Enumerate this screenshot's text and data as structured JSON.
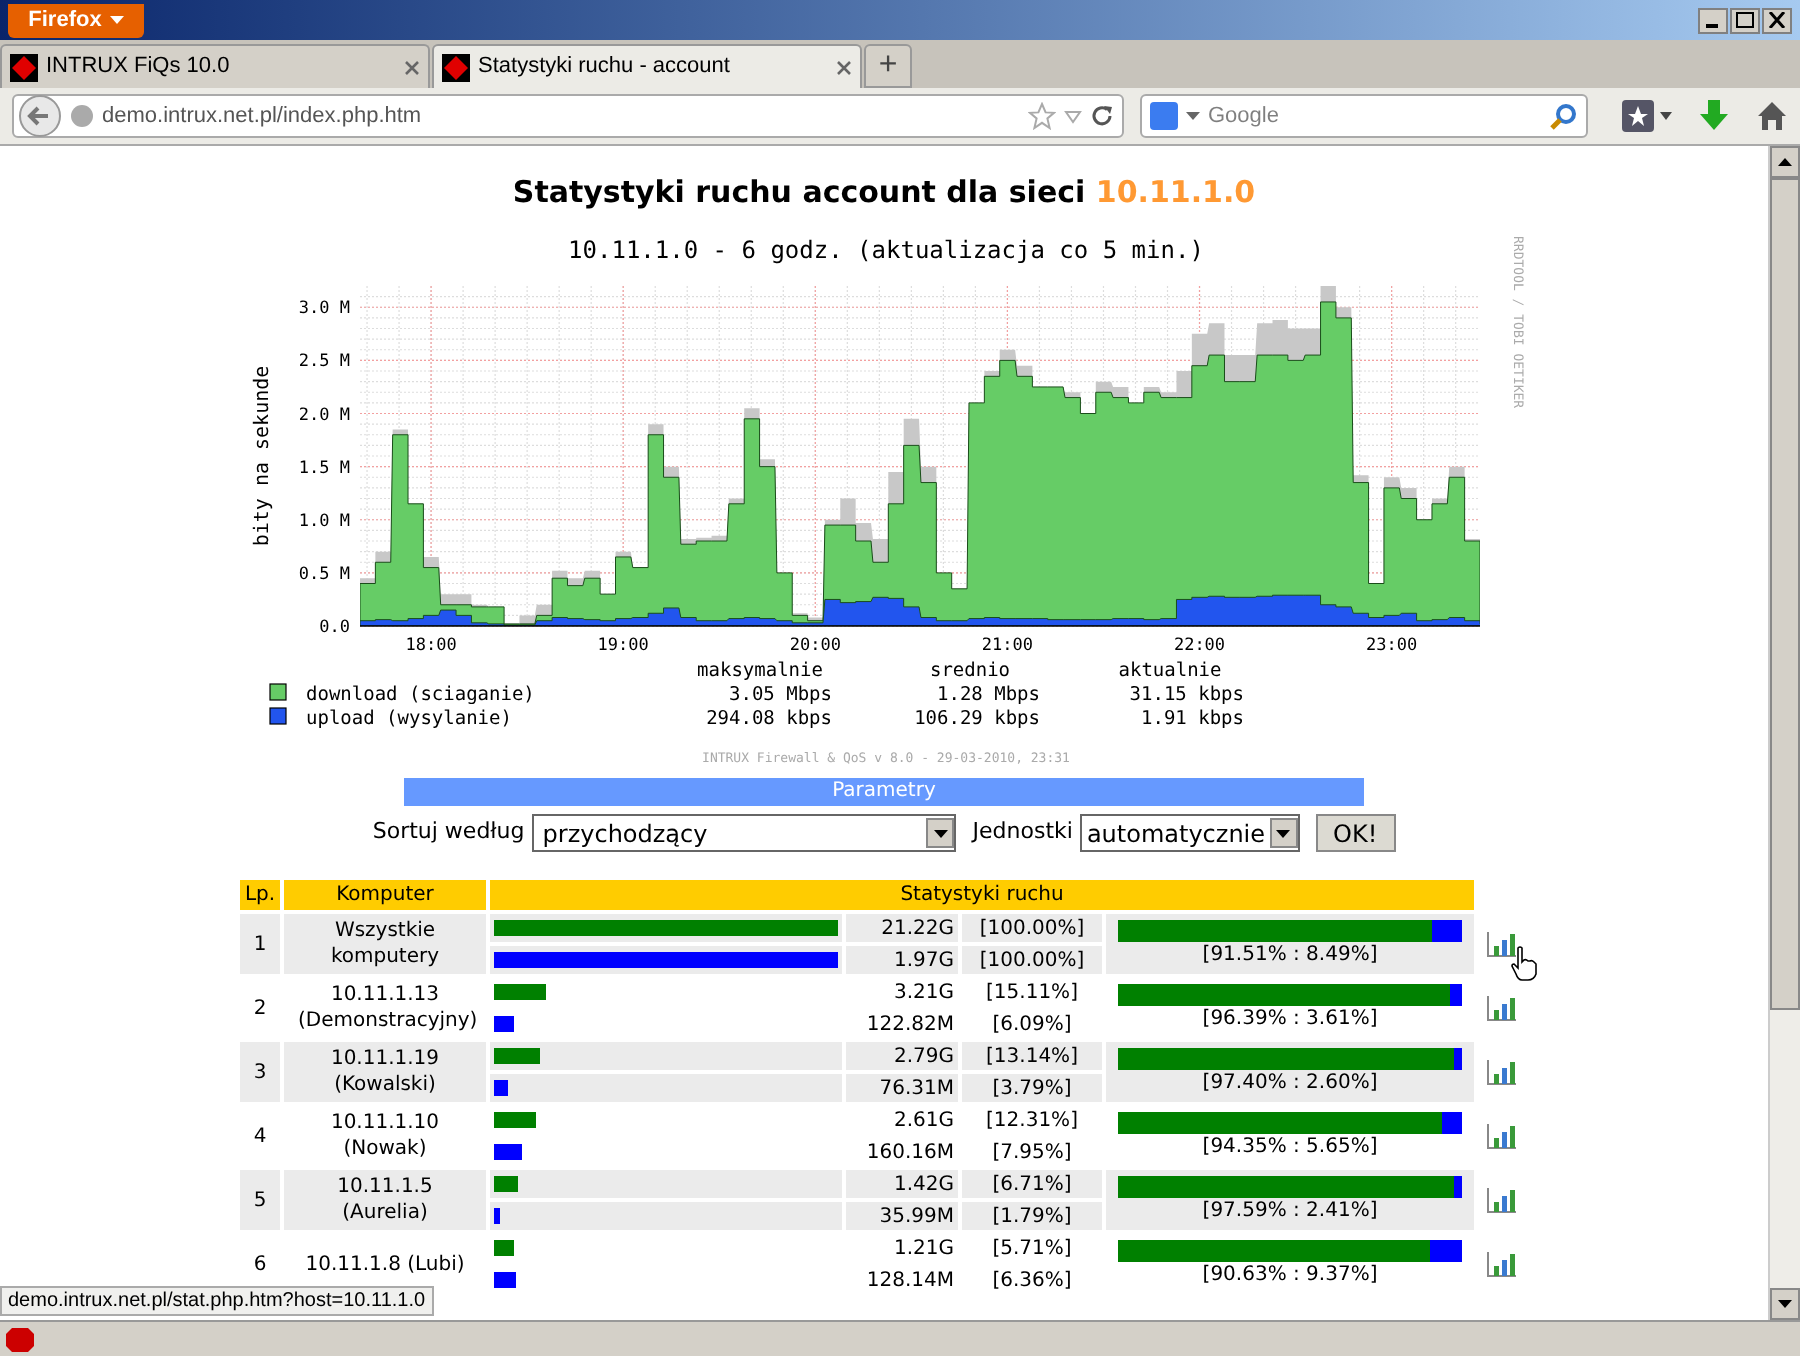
{
  "browser": {
    "menu_button": "Firefox",
    "tabs": [
      {
        "title": "INTRUX FiQs 10.0",
        "selected": false
      },
      {
        "title": "Statystyki ruchu - account",
        "selected": true
      }
    ],
    "new_tab": "+",
    "url": "demo.intrux.net.pl/index.php.htm",
    "search_placeholder": "Google"
  },
  "page": {
    "title": "Statystyki ruchu account dla sieci ",
    "network": "10.11.1.0",
    "graph": {
      "subtitle": "10.11.1.0 - 6 godz. (aktualizacja co 5 min.)",
      "credit": "RRDTOOL / TOBI OETIKER",
      "footer": "INTRUX Firewall & QoS v 8.0 - 29-03-2010, 23:31",
      "chart_data": {
        "type": "area",
        "ylabel": "bity na sekunde",
        "xlim": [
          17.63,
          23.46
        ],
        "ylim": [
          0,
          3.2
        ],
        "grid": true,
        "legend": "bottom",
        "xticks": [
          {
            "value": 18,
            "label": "18:00"
          },
          {
            "value": 19,
            "label": "19:00"
          },
          {
            "value": 20,
            "label": "20:00"
          },
          {
            "value": 21,
            "label": "21:00"
          },
          {
            "value": 22,
            "label": "22:00"
          },
          {
            "value": 23,
            "label": "23:00"
          }
        ],
        "yticks": [
          {
            "value": 0,
            "label": "0.0"
          },
          {
            "value": 0.5,
            "label": "0.5 M"
          },
          {
            "value": 1,
            "label": "1.0 M"
          },
          {
            "value": 1.5,
            "label": "1.5 M"
          },
          {
            "value": 2,
            "label": "2.0 M"
          },
          {
            "value": 2.5,
            "label": "2.5 M"
          },
          {
            "value": 3,
            "label": "3.0 M"
          }
        ],
        "x": [
          17.63,
          17.71,
          17.8,
          17.88,
          17.96,
          18.05,
          18.13,
          18.21,
          18.3,
          18.38,
          18.46,
          18.55,
          18.63,
          18.71,
          18.8,
          18.88,
          18.96,
          19.05,
          19.13,
          19.21,
          19.3,
          19.38,
          19.46,
          19.55,
          19.63,
          19.71,
          19.8,
          19.88,
          19.96,
          20.05,
          20.13,
          20.21,
          20.3,
          20.38,
          20.46,
          20.55,
          20.63,
          20.71,
          20.8,
          20.88,
          20.96,
          21.05,
          21.13,
          21.21,
          21.3,
          21.38,
          21.46,
          21.55,
          21.63,
          21.71,
          21.8,
          21.88,
          21.96,
          22.05,
          22.13,
          22.21,
          22.3,
          22.38,
          22.46,
          22.55,
          22.63,
          22.71,
          22.8,
          22.88,
          22.96,
          23.05,
          23.13,
          23.21,
          23.3,
          23.38,
          23.46
        ],
        "series": [
          {
            "color": "#c8c8c8",
            "values": [
              0.45,
              0.7,
              1.85,
              1.15,
              0.65,
              0.3,
              0.3,
              0.2,
              0.18,
              0.02,
              0.1,
              0.2,
              0.52,
              0.45,
              0.52,
              0.3,
              0.7,
              0.55,
              1.9,
              1.5,
              0.82,
              0.83,
              0.85,
              1.2,
              2.05,
              1.57,
              0.5,
              0.12,
              0.08,
              1.0,
              1.2,
              0.97,
              0.82,
              1.45,
              1.95,
              1.5,
              0.5,
              0.35,
              2.1,
              2.4,
              2.6,
              2.45,
              2.25,
              2.22,
              2.2,
              2.0,
              2.3,
              2.25,
              2.1,
              2.25,
              2.2,
              2.4,
              2.75,
              2.85,
              2.55,
              2.55,
              2.85,
              2.88,
              2.8,
              2.8,
              3.2,
              3.0,
              1.42,
              0.4,
              1.4,
              1.3,
              1.0,
              1.2,
              1.5,
              0.82,
              0.05
            ]
          },
          {
            "name": "download (sciaganie)",
            "color": "#66cc66",
            "values": [
              0.4,
              0.6,
              1.8,
              1.15,
              0.55,
              0.2,
              0.2,
              0.18,
              0.18,
              0.02,
              0.02,
              0.1,
              0.45,
              0.38,
              0.45,
              0.3,
              0.65,
              0.55,
              1.8,
              1.4,
              0.77,
              0.8,
              0.8,
              1.15,
              1.95,
              1.5,
              0.5,
              0.1,
              0.05,
              0.95,
              0.95,
              0.8,
              0.6,
              1.15,
              1.7,
              1.35,
              0.5,
              0.35,
              2.1,
              2.35,
              2.5,
              2.35,
              2.25,
              2.25,
              2.15,
              2.0,
              2.2,
              2.15,
              2.1,
              2.2,
              2.15,
              2.15,
              2.45,
              2.55,
              2.3,
              2.3,
              2.55,
              2.55,
              2.5,
              2.55,
              3.05,
              2.9,
              1.35,
              0.4,
              1.3,
              1.2,
              1.0,
              1.15,
              1.4,
              0.8,
              0.03
            ]
          },
          {
            "name": "upload (wysylanie)",
            "color": "#2255ee",
            "values": [
              0.05,
              0.06,
              0.05,
              0.07,
              0.1,
              0.15,
              0.1,
              0.03,
              0.02,
              0.01,
              0.01,
              0.05,
              0.08,
              0.07,
              0.06,
              0.05,
              0.07,
              0.08,
              0.12,
              0.17,
              0.08,
              0.05,
              0.05,
              0.07,
              0.08,
              0.07,
              0.05,
              0.03,
              0.03,
              0.25,
              0.22,
              0.23,
              0.27,
              0.26,
              0.18,
              0.08,
              0.05,
              0.05,
              0.07,
              0.08,
              0.07,
              0.07,
              0.07,
              0.06,
              0.06,
              0.06,
              0.06,
              0.07,
              0.07,
              0.06,
              0.07,
              0.25,
              0.27,
              0.28,
              0.27,
              0.27,
              0.28,
              0.29,
              0.29,
              0.29,
              0.2,
              0.18,
              0.12,
              0.08,
              0.1,
              0.12,
              0.05,
              0.06,
              0.08,
              0.05,
              0.02
            ]
          }
        ]
      },
      "legend_columns": [
        "maksymalnie",
        "srednio",
        "aktualnie"
      ],
      "legend_values": [
        [
          "3.05 Mbps",
          "1.28 Mbps",
          "31.15 kbps"
        ],
        [
          "294.08 kbps",
          "106.29 kbps",
          "1.91 kbps"
        ]
      ]
    },
    "parameters": {
      "title": "Parametry",
      "sort_label": "Sortuj według",
      "sort_value": "przychodzący",
      "units_label": "Jednostki",
      "units_value": "automatycznie",
      "submit": "OK!"
    },
    "table": {
      "columns": [
        "Lp.",
        "Komputer",
        "Statystyki ruchu"
      ],
      "rows": [
        {
          "lp": "1",
          "name": "Wszystkie komputery",
          "download": {
            "value": "21.22G",
            "percent": "[100.00%]",
            "level": 1
          },
          "upload": {
            "value": "1.97G",
            "percent": "[100.00%]",
            "level": 1
          },
          "ratio": {
            "level": 0.9151,
            "text": "[91.51% : 8.49%]"
          }
        },
        {
          "lp": "2",
          "name": "10.11.1.13 (Demonstracyjny)",
          "download": {
            "value": "3.21G",
            "percent": "[15.11%]",
            "level": 0.1511
          },
          "upload": {
            "value": "122.82M",
            "percent": "[6.09%]",
            "level": 0.0609
          },
          "ratio": {
            "level": 0.9639,
            "text": "[96.39% : 3.61%]"
          }
        },
        {
          "lp": "3",
          "name": "10.11.1.19 (Kowalski)",
          "download": {
            "value": "2.79G",
            "percent": "[13.14%]",
            "level": 0.1314
          },
          "upload": {
            "value": "76.31M",
            "percent": "[3.79%]",
            "level": 0.0379
          },
          "ratio": {
            "level": 0.974,
            "text": "[97.40% : 2.60%]"
          }
        },
        {
          "lp": "4",
          "name": "10.11.1.10 (Nowak)",
          "download": {
            "value": "2.61G",
            "percent": "[12.31%]",
            "level": 0.1231
          },
          "upload": {
            "value": "160.16M",
            "percent": "[7.95%]",
            "level": 0.0795
          },
          "ratio": {
            "level": 0.9435,
            "text": "[94.35% : 5.65%]"
          }
        },
        {
          "lp": "5",
          "name": "10.11.1.5 (Aurelia)",
          "download": {
            "value": "1.42G",
            "percent": "[6.71%]",
            "level": 0.0671
          },
          "upload": {
            "value": "35.99M",
            "percent": "[1.79%]",
            "level": 0.0179
          },
          "ratio": {
            "level": 0.9759,
            "text": "[97.59% : 2.41%]"
          }
        },
        {
          "lp": "6",
          "name": "10.11.1.8 (Lubi)",
          "download": {
            "value": "1.21G",
            "percent": "[5.71%]",
            "level": 0.0571
          },
          "upload": {
            "value": "128.14M",
            "percent": "[6.36%]",
            "level": 0.0636
          },
          "ratio": {
            "level": 0.9063,
            "text": "[90.63% : 9.37%]"
          }
        }
      ]
    }
  },
  "status_link": "demo.intrux.net.pl/stat.php.htm?host=10.11.1.0"
}
